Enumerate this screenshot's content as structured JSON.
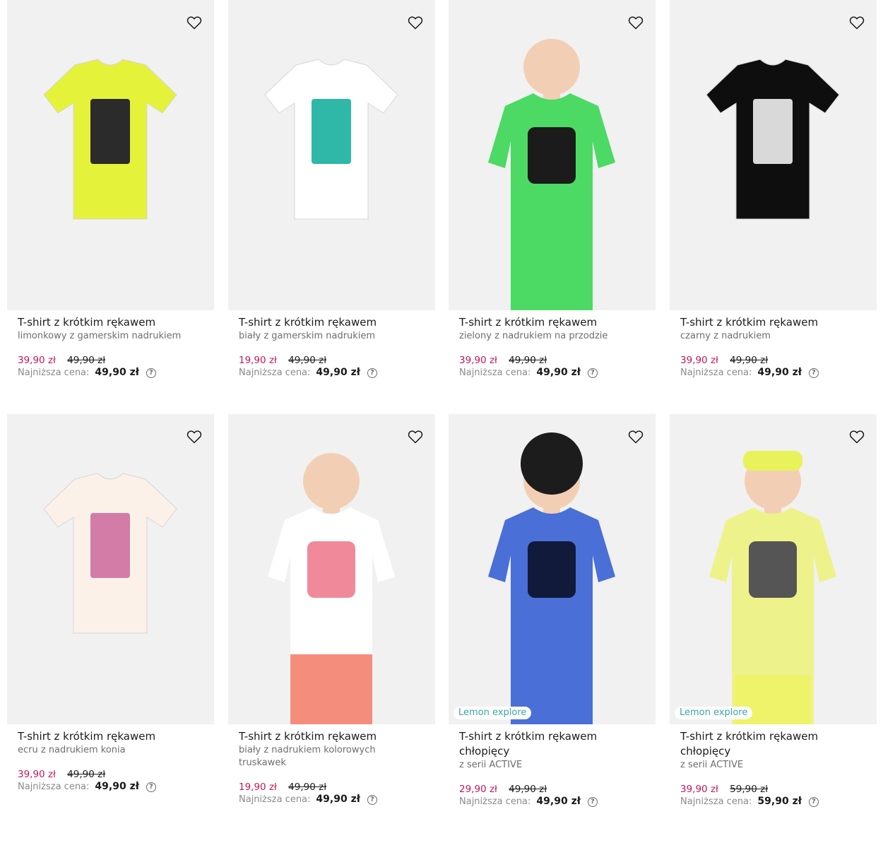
{
  "products": [
    {
      "title": "T-shirt z krótkim rękawem",
      "subtitle": "limonkowy z gamerskim nadrukiem",
      "price": "39,90 zł",
      "old_price": "49,90 zł",
      "lowest_label": "Najniższa cena:",
      "lowest_value": "49,90 zł",
      "badge": "",
      "shirt_color": "#e4f23a",
      "print_color": "#2b2b2b"
    },
    {
      "title": "T-shirt z krótkim rękawem",
      "subtitle": "biały z gamerskim nadrukiem",
      "price": "19,90 zł",
      "old_price": "49,90 zł",
      "lowest_label": "Najniższa cena:",
      "lowest_value": "49,90 zł",
      "badge": "",
      "shirt_color": "#ffffff",
      "print_color": "#2fb7a8"
    },
    {
      "title": "T-shirt z krótkim rękawem",
      "subtitle": "zielony z nadrukiem na przodzie",
      "price": "39,90 zł",
      "old_price": "49,90 zł",
      "lowest_label": "Najniższa cena:",
      "lowest_value": "49,90 zł",
      "badge": "",
      "shirt_color": "#4cd964",
      "print_color": "#1b1b1b"
    },
    {
      "title": "T-shirt z krótkim rękawem",
      "subtitle": "czarny z nadrukiem",
      "price": "39,90 zł",
      "old_price": "49,90 zł",
      "lowest_label": "Najniższa cena:",
      "lowest_value": "49,90 zł",
      "badge": "",
      "shirt_color": "#0e0e0e",
      "print_color": "#d9d9d9"
    },
    {
      "title": "T-shirt z krótkim rękawem",
      "subtitle": "ecru z nadrukiem konia",
      "price": "39,90 zł",
      "old_price": "49,90 zł",
      "lowest_label": "Najniższa cena:",
      "lowest_value": "49,90 zł",
      "badge": "",
      "shirt_color": "#fbf1e8",
      "print_color": "#d47ca8"
    },
    {
      "title": "T-shirt z krótkim rękawem",
      "subtitle": "biały z nadrukiem kolorowych truskawek",
      "price": "19,90 zł",
      "old_price": "49,90 zł",
      "lowest_label": "Najniższa cena:",
      "lowest_value": "49,90 zł",
      "badge": "",
      "shirt_color": "#ffffff",
      "print_color": "#f08a9a"
    },
    {
      "title": "T-shirt z krótkim rękawem chłopięcy",
      "subtitle": "z serii ACTIVE",
      "price": "29,90 zł",
      "old_price": "49,90 zł",
      "lowest_label": "Najniższa cena:",
      "lowest_value": "49,90 zł",
      "badge": "Lemon explore",
      "shirt_color": "#4a6fd6",
      "print_color": "#111a3a"
    },
    {
      "title": "T-shirt z krótkim rękawem chłopięcy",
      "subtitle": "z serii ACTIVE",
      "price": "39,90 zł",
      "old_price": "59,90 zł",
      "lowest_label": "Najniższa cena:",
      "lowest_value": "59,90 zł",
      "badge": "Lemon explore",
      "shirt_color": "#eef28a",
      "print_color": "#555555"
    }
  ]
}
